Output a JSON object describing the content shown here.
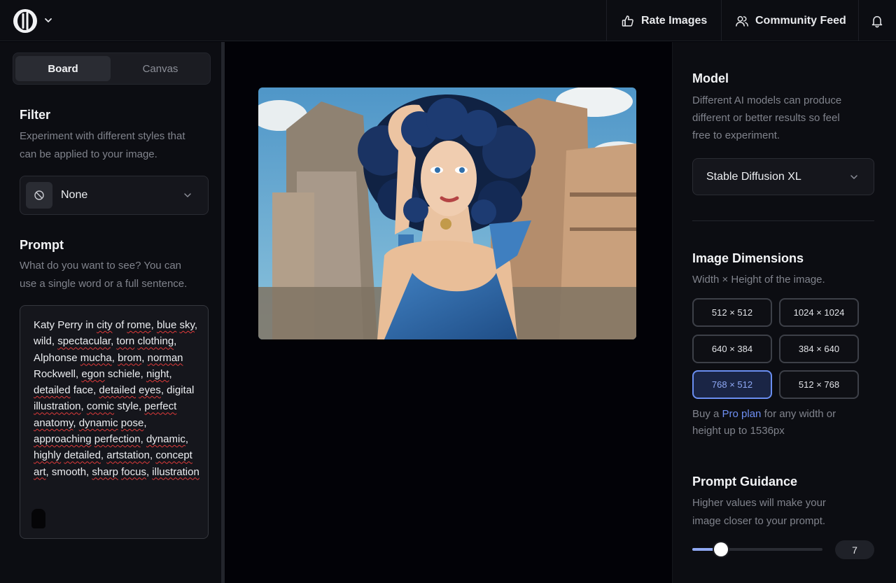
{
  "header": {
    "rate_images": "Rate Images",
    "community_feed": "Community Feed"
  },
  "left": {
    "tabs": [
      "Board",
      "Canvas"
    ],
    "filter": {
      "title": "Filter",
      "desc_lines": [
        "Experiment with different styles that",
        "can be applied to your image."
      ],
      "value": "None"
    },
    "prompt": {
      "title": "Prompt",
      "desc_lines": [
        "What do you want to see? You can",
        "use a single word or a full sentence."
      ],
      "value": "Katy Perry in city of rome, blue sky, wild, spectacular, torn clothing, Alphonse mucha, brom, norman Rockwell, egon schiele, night, detailed face, detailed eyes, digital illustration, comic style, perfect anatomy, dynamic pose, approaching perfection, dynamic, highly detailed, artstation, concept art, smooth, sharp focus, illustration"
    }
  },
  "right": {
    "model": {
      "title": "Model",
      "desc_lines": [
        "Different AI models can produce",
        "different or better results so feel",
        "free to experiment."
      ],
      "value": "Stable Diffusion XL"
    },
    "dimensions": {
      "title": "Image Dimensions",
      "desc": "Width × Height of the image.",
      "options": [
        "512 × 512",
        "1024 × 1024",
        "640 × 384",
        "384 × 640",
        "768 × 512",
        "512 × 768"
      ],
      "selected": "768 × 512",
      "pro_prefix": "Buy a ",
      "pro_link": "Pro plan",
      "pro_suffix": " for any width or",
      "pro_line2": "height up to 1536px"
    },
    "guidance": {
      "title": "Prompt Guidance",
      "desc_lines": [
        "Higher values will make your",
        "image closer to your prompt."
      ],
      "value": "7",
      "level_fraction": 0.22
    }
  },
  "colors": {
    "accent": "#6e8ff3",
    "panel_bg": "#0c0d12",
    "page_bg": "#020207",
    "spell_underline": "#e03a3a"
  },
  "icons": {
    "logo": "app-logo-icon",
    "rate": "thumbs-up-icon",
    "community": "users-icon",
    "notifications": "bell-icon",
    "filter": "no-filter-icon"
  }
}
